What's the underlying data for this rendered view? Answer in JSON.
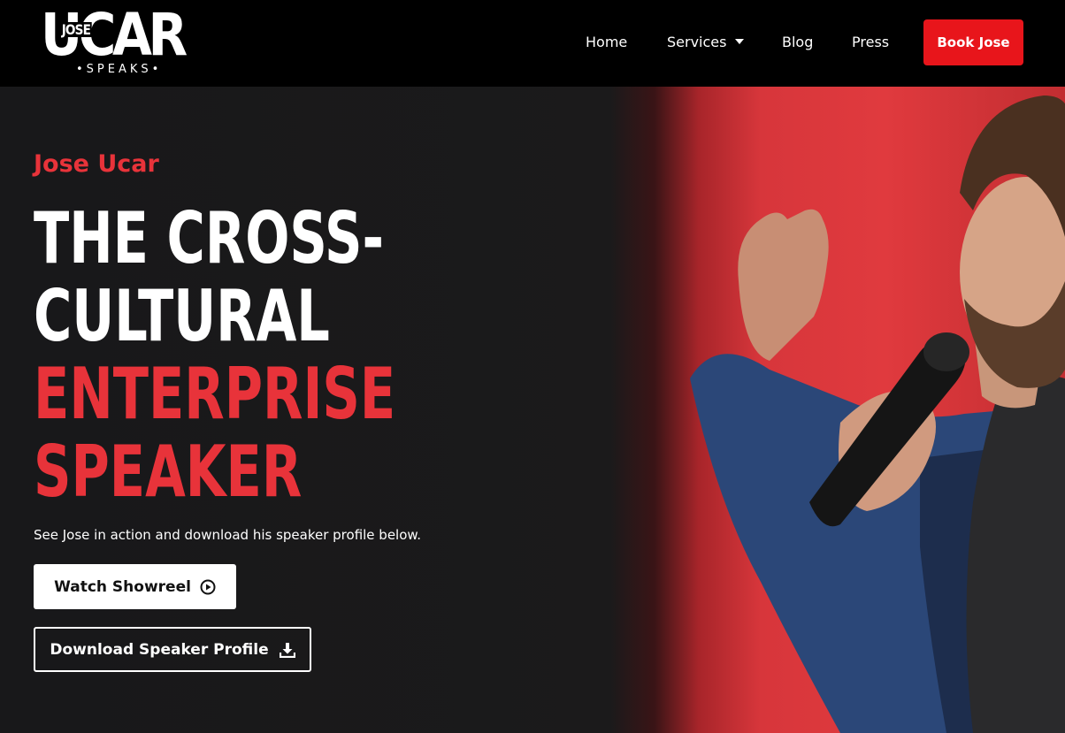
{
  "logo": {
    "main": "UCAR",
    "sub": "JOSE",
    "tagline": "•SPEAKS•"
  },
  "nav": {
    "items": [
      {
        "label": "Home"
      },
      {
        "label": "Services"
      },
      {
        "label": "Blog"
      },
      {
        "label": "Press"
      }
    ],
    "cta_label": "Book Jose"
  },
  "hero": {
    "eyebrow": "Jose Ucar",
    "headline_white_1": "THE CROSS-",
    "headline_white_2": "CULTURAL",
    "headline_red_1": "ENTERPRISE",
    "headline_red_2": "SPEAKER",
    "subtext": "See Jose in action and download his speaker profile below.",
    "watch_label": "Watch Showreel",
    "download_label": "Download Speaker Profile"
  },
  "colors": {
    "accent_red": "#e8333a",
    "cta_red": "#e8151b",
    "background": "#18181a",
    "header": "#000000"
  }
}
